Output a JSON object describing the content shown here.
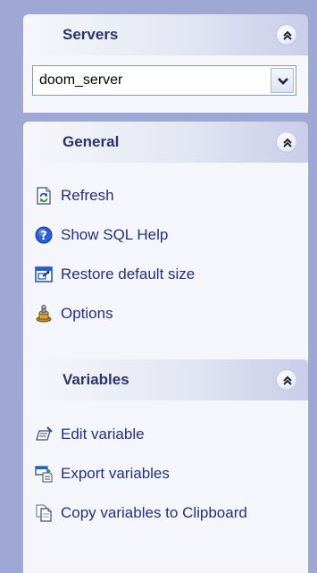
{
  "servers": {
    "title": "Servers",
    "selected_server": "doom_server"
  },
  "general": {
    "title": "General",
    "items": [
      {
        "label": "Refresh",
        "icon": "refresh-icon"
      },
      {
        "label": "Show SQL Help",
        "icon": "help-icon"
      },
      {
        "label": "Restore default size",
        "icon": "restore-size-icon"
      },
      {
        "label": "Options",
        "icon": "options-icon"
      }
    ]
  },
  "variables": {
    "title": "Variables",
    "items": [
      {
        "label": "Edit variable",
        "icon": "edit-variable-icon"
      },
      {
        "label": "Export variables",
        "icon": "export-variables-icon"
      },
      {
        "label": "Copy variables to Clipboard",
        "icon": "copy-clipboard-icon"
      }
    ]
  },
  "colors": {
    "background": "#9fa8d4",
    "header_text": "#2b3468",
    "link_text": "#24307d",
    "pane_body": "#f5f6fc"
  }
}
